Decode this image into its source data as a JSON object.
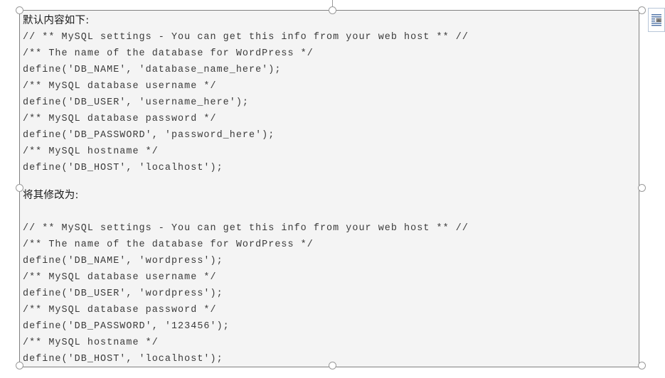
{
  "document": {
    "selected_object": {
      "label": "selected-picture",
      "border_color": "#808080",
      "background_color": "#f4f4f4",
      "handle_color": "#9a9a9a"
    },
    "content_lines": [
      {
        "type": "cjk",
        "text": "默认内容如下:"
      },
      {
        "type": "code",
        "text": "// ** MySQL settings - You can get this info from your web host ** //"
      },
      {
        "type": "code",
        "text": "/** The name of the database for WordPress */"
      },
      {
        "type": "code",
        "text": "define('DB_NAME', 'database_name_here');"
      },
      {
        "type": "code",
        "text": "/** MySQL database username */"
      },
      {
        "type": "code",
        "text": "define('DB_USER', 'username_here');"
      },
      {
        "type": "code",
        "text": "/** MySQL database password */"
      },
      {
        "type": "code",
        "text": "define('DB_PASSWORD', 'password_here');"
      },
      {
        "type": "code",
        "text": "/** MySQL hostname */"
      },
      {
        "type": "code",
        "text": "define('DB_HOST', 'localhost');"
      },
      {
        "type": "gap",
        "text": ""
      },
      {
        "type": "cjk",
        "text": "将其修改为:"
      },
      {
        "type": "blank",
        "text": ""
      },
      {
        "type": "code",
        "text": "// ** MySQL settings - You can get this info from your web host ** //"
      },
      {
        "type": "code",
        "text": "/** The name of the database for WordPress */"
      },
      {
        "type": "code",
        "text": "define('DB_NAME', 'wordpress');"
      },
      {
        "type": "code",
        "text": "/** MySQL database username */"
      },
      {
        "type": "code",
        "text": "define('DB_USER', 'wordpress');"
      },
      {
        "type": "code",
        "text": "/** MySQL database password */"
      },
      {
        "type": "code",
        "text": "define('DB_PASSWORD', '123456');"
      },
      {
        "type": "code",
        "text": "/** MySQL hostname */"
      },
      {
        "type": "code",
        "text": "define('DB_HOST', 'localhost');"
      }
    ]
  },
  "layout_options": {
    "icon": "layout-options-icon",
    "tooltip": "Layout Options"
  }
}
